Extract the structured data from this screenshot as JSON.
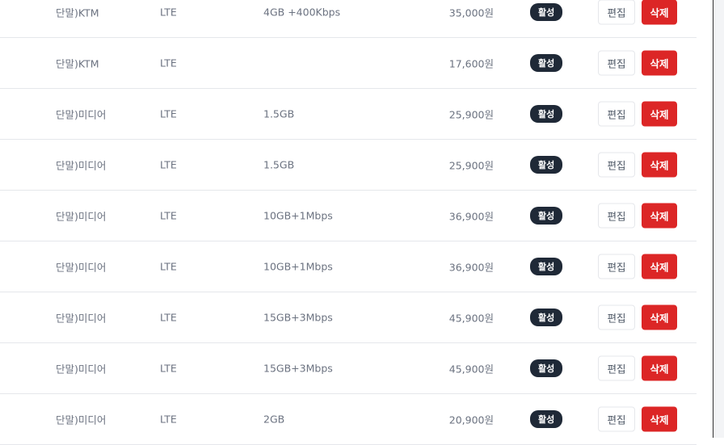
{
  "rows": [
    {
      "carrier": "단말)KTM",
      "network": "LTE",
      "data": "4GB +400Kbps",
      "price": "35,000원",
      "status": "활성",
      "edit": "편집",
      "delete": "삭제"
    },
    {
      "carrier": "단말)KTM",
      "network": "LTE",
      "data": "",
      "price": "17,600원",
      "status": "활성",
      "edit": "편집",
      "delete": "삭제"
    },
    {
      "carrier": "단말)미디어",
      "network": "LTE",
      "data": "1.5GB",
      "price": "25,900원",
      "status": "활성",
      "edit": "편집",
      "delete": "삭제"
    },
    {
      "carrier": "단말)미디어",
      "network": "LTE",
      "data": "1.5GB",
      "price": "25,900원",
      "status": "활성",
      "edit": "편집",
      "delete": "삭제"
    },
    {
      "carrier": "단말)미디어",
      "network": "LTE",
      "data": "10GB+1Mbps",
      "price": "36,900원",
      "status": "활성",
      "edit": "편집",
      "delete": "삭제"
    },
    {
      "carrier": "단말)미디어",
      "network": "LTE",
      "data": "10GB+1Mbps",
      "price": "36,900원",
      "status": "활성",
      "edit": "편집",
      "delete": "삭제"
    },
    {
      "carrier": "단말)미디어",
      "network": "LTE",
      "data": "15GB+3Mbps",
      "price": "45,900원",
      "status": "활성",
      "edit": "편집",
      "delete": "삭제"
    },
    {
      "carrier": "단말)미디어",
      "network": "LTE",
      "data": "15GB+3Mbps",
      "price": "45,900원",
      "status": "활성",
      "edit": "편집",
      "delete": "삭제"
    },
    {
      "carrier": "단말)미디어",
      "network": "LTE",
      "data": "2GB",
      "price": "20,900원",
      "status": "활성",
      "edit": "편집",
      "delete": "삭제"
    }
  ]
}
